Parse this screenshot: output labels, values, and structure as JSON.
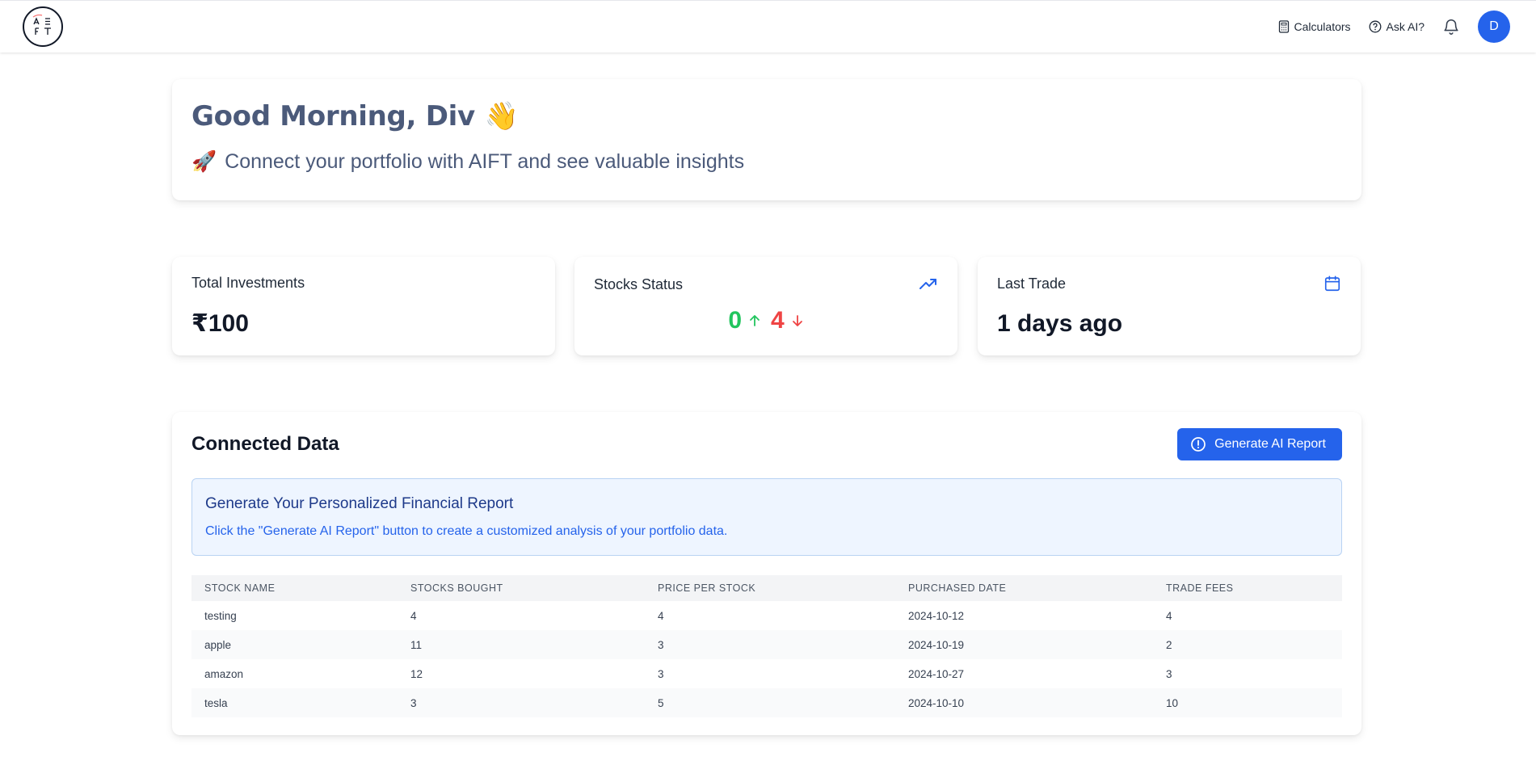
{
  "nav": {
    "logo_text": "AIFT",
    "calculators_label": "Calculators",
    "ask_ai_label": "Ask AI?",
    "avatar_initial": "D"
  },
  "welcome": {
    "greeting": "Good Morning, Div",
    "greeting_emoji": "👋",
    "subtitle": "Connect your portfolio with AIFT and see valuable insights",
    "subtitle_emoji": "🚀"
  },
  "stats": {
    "total_investments": {
      "label": "Total Investments",
      "value": "₹100"
    },
    "stocks_status": {
      "label": "Stocks Status",
      "up_count": "0",
      "down_count": "4",
      "icon": "trending-up-icon"
    },
    "last_trade": {
      "label": "Last Trade",
      "value": "1 days ago",
      "icon": "calendar-icon"
    }
  },
  "connected": {
    "title": "Connected Data",
    "button_label": "Generate AI Report",
    "info_title": "Generate Your Personalized Financial Report",
    "info_desc": "Click the \"Generate AI Report\" button to create a customized analysis of your portfolio data.",
    "columns": [
      "STOCK NAME",
      "STOCKS BOUGHT",
      "PRICE PER STOCK",
      "PURCHASED DATE",
      "TRADE FEES"
    ],
    "rows": [
      [
        "testing",
        "4",
        "4",
        "2024-10-12",
        "4"
      ],
      [
        "apple",
        "11",
        "3",
        "2024-10-19",
        "2"
      ],
      [
        "amazon",
        "12",
        "3",
        "2024-10-27",
        "3"
      ],
      [
        "tesla",
        "3",
        "5",
        "2024-10-10",
        "10"
      ]
    ]
  },
  "colors": {
    "accent": "#2563eb",
    "up": "#22c55e",
    "down": "#ef4444",
    "heading": "#4b5a7a"
  }
}
